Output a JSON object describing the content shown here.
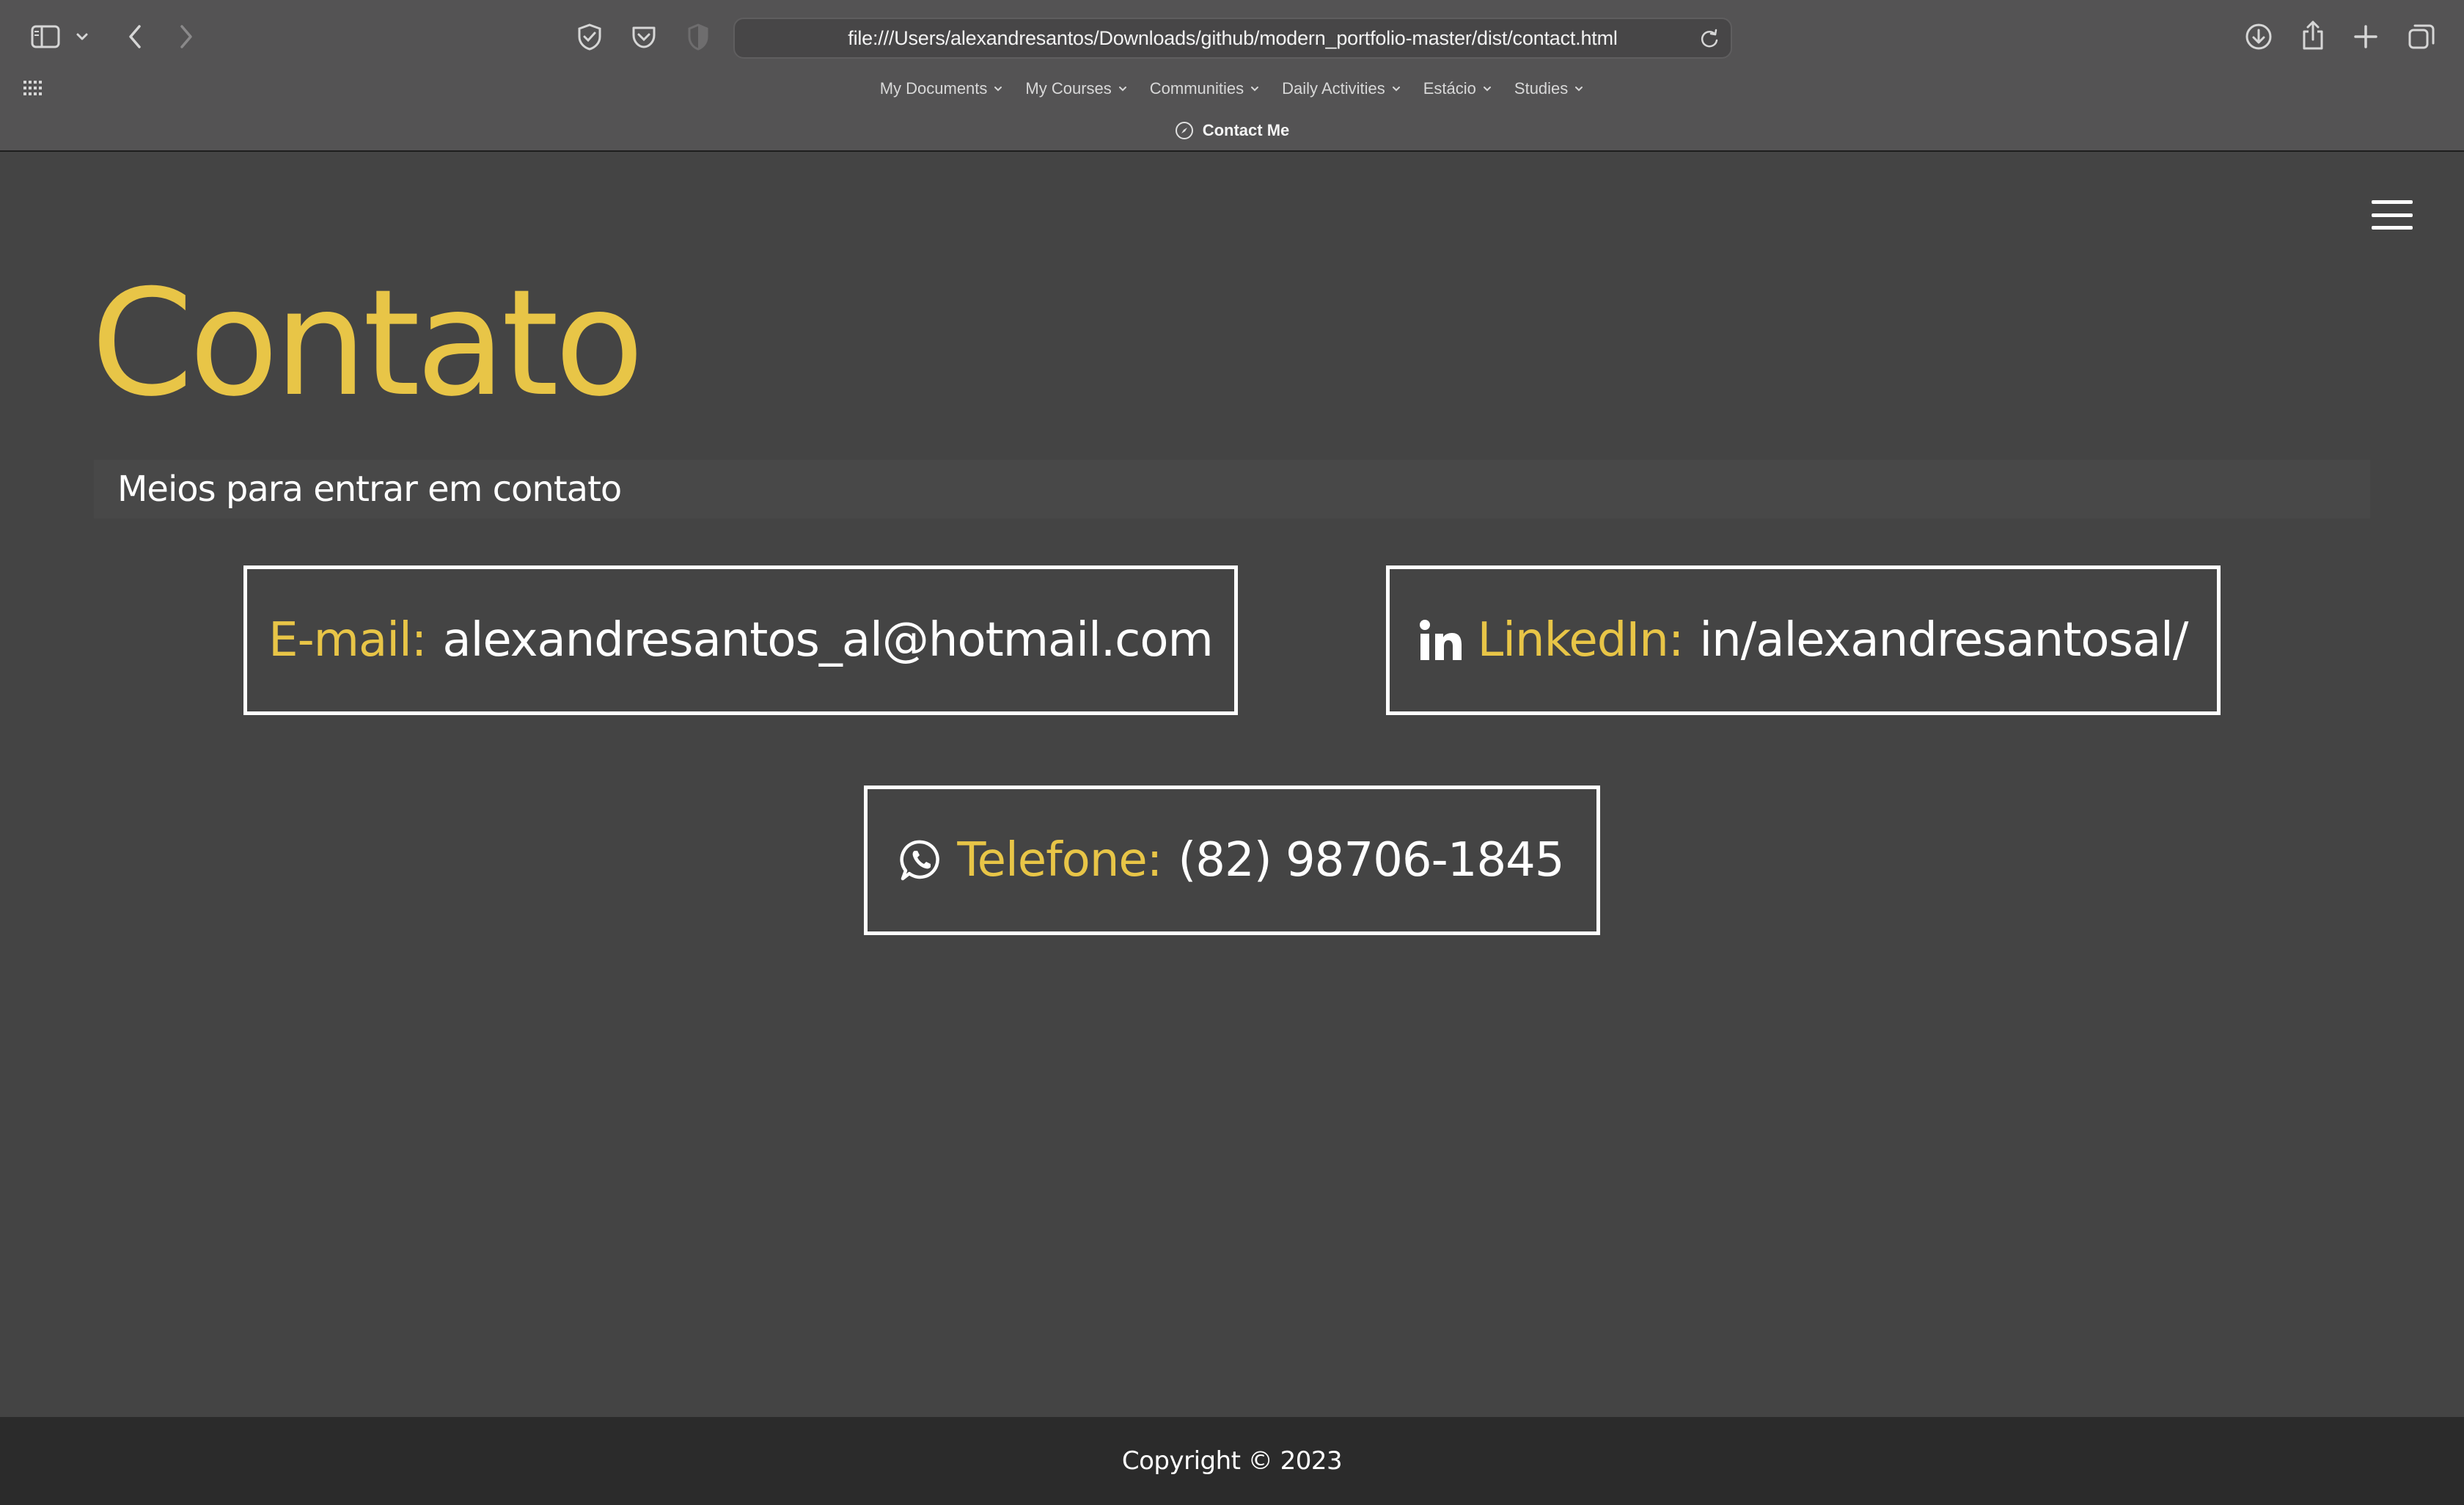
{
  "browser": {
    "url": "file:///Users/alexandresantos/Downloads/github/modern_portfolio-master/dist/contact.html",
    "tab_title": "Contact Me",
    "bookmarks": [
      {
        "label": "My Documents"
      },
      {
        "label": "My Courses"
      },
      {
        "label": "Communities"
      },
      {
        "label": "Daily Activities"
      },
      {
        "label": "Estácio"
      },
      {
        "label": "Studies"
      }
    ],
    "icons": [
      "sidebar-icon",
      "chevron-down-icon",
      "back-icon",
      "forward-icon",
      "shield-icon",
      "pocket-icon",
      "privacy-icon",
      "reload-icon",
      "download-icon",
      "share-icon",
      "new-tab-icon",
      "tab-overview-icon",
      "apps-grid-icon",
      "compass-icon"
    ]
  },
  "page": {
    "title": "Contato",
    "subtitle": "Meios para entrar em contato",
    "menu_icon": "hamburger-menu-icon",
    "contacts": {
      "email": {
        "label": "E-mail:",
        "value": "alexandresantos_al@hotmail.com"
      },
      "linkedin": {
        "label": "LinkedIn:",
        "value": "in/alexandresantosal/",
        "icon": "linkedin-icon"
      },
      "phone": {
        "label": "Telefone:",
        "value": "(82) 98706-1845",
        "icon": "whatsapp-icon"
      }
    },
    "footer": "Copyright © 2023"
  },
  "colors": {
    "accent": "#e8c547",
    "page_bg": "#444444",
    "footer_bg": "#2b2b2b",
    "chrome_bg": "#545354",
    "text": "#ffffff"
  }
}
